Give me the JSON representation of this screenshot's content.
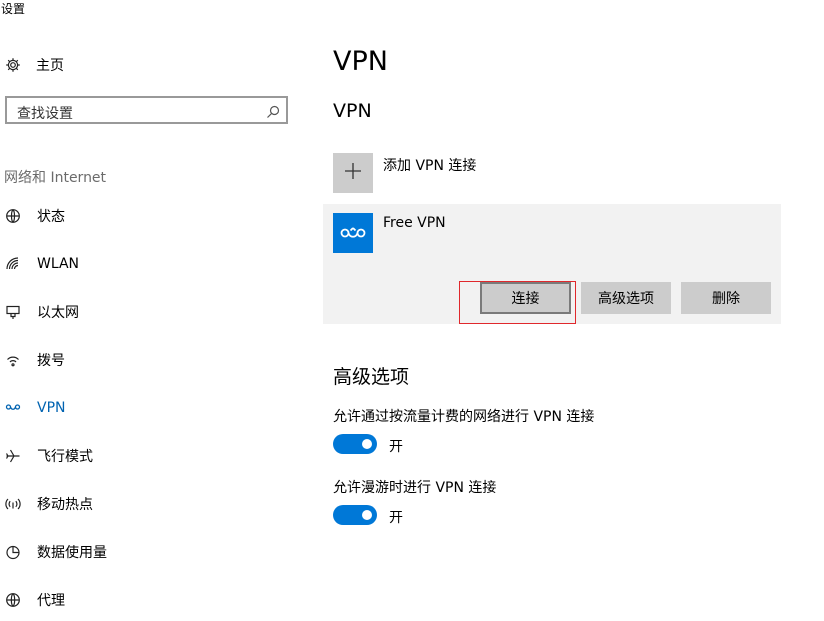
{
  "window": {
    "title": "设置"
  },
  "sidebar": {
    "home_label": "主页",
    "search_placeholder": "查找设置",
    "section_label": "网络和 Internet",
    "items": [
      {
        "label": "状态",
        "icon": "globe-status-icon"
      },
      {
        "label": "WLAN",
        "icon": "wifi-icon"
      },
      {
        "label": "以太网",
        "icon": "ethernet-icon"
      },
      {
        "label": "拨号",
        "icon": "dialup-icon"
      },
      {
        "label": "VPN",
        "icon": "vpn-icon",
        "active": true
      },
      {
        "label": "飞行模式",
        "icon": "airplane-icon"
      },
      {
        "label": "移动热点",
        "icon": "hotspot-icon"
      },
      {
        "label": "数据使用量",
        "icon": "data-usage-icon"
      },
      {
        "label": "代理",
        "icon": "proxy-globe-icon"
      }
    ]
  },
  "main": {
    "title": "VPN",
    "subtitle": "VPN",
    "add_connection_label": "添加 VPN 连接",
    "connection": {
      "name": "Free VPN",
      "buttons": {
        "connect": "连接",
        "advanced": "高级选项",
        "delete": "删除"
      }
    },
    "advanced": {
      "title": "高级选项",
      "options": [
        {
          "label": "允许通过按流量计费的网络进行 VPN 连接",
          "state": "开",
          "on": true
        },
        {
          "label": "允许漫游时进行 VPN 连接",
          "state": "开",
          "on": true
        }
      ]
    }
  },
  "colors": {
    "accent": "#0078d7",
    "active_nav": "#0063b1",
    "button": "#cccccc",
    "card": "#f2f2f2",
    "highlight_box": "#e0282c"
  }
}
